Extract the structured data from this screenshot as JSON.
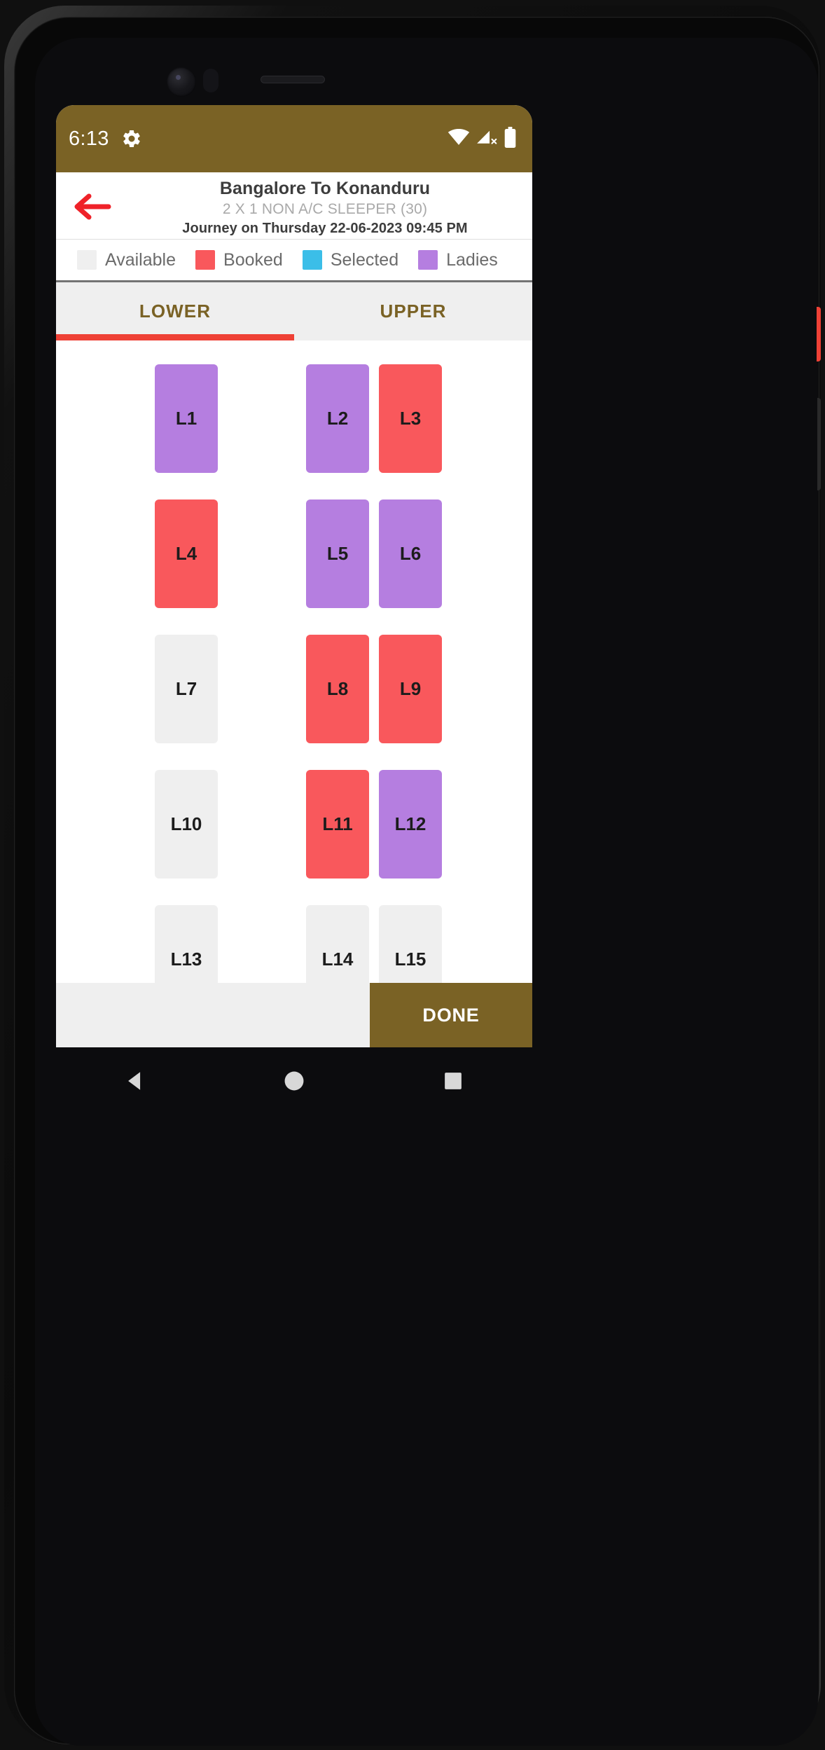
{
  "status_bar": {
    "time": "6:13",
    "gear_icon": "gear-icon",
    "wifi_icon": "wifi-icon",
    "signal_icon": "cellular-signal-off-icon",
    "battery_icon": "battery-icon",
    "background_color": "#7a6225"
  },
  "header": {
    "back_icon": "back-arrow-icon",
    "back_icon_color": "#ef2229",
    "route_title": "Bangalore To Konanduru",
    "bus_type": "2 X 1 NON A/C SLEEPER (30)",
    "journey_info": "Journey on Thursday 22-06-2023  09:45 PM"
  },
  "legend": {
    "items": [
      {
        "label": "Available",
        "color": "#efefef"
      },
      {
        "label": "Booked",
        "color": "#f9585c"
      },
      {
        "label": "Selected",
        "color": "#3bbee8"
      },
      {
        "label": "Ladies",
        "color": "#b57ee0"
      }
    ]
  },
  "tabs": {
    "items": [
      {
        "label": "LOWER",
        "active": true
      },
      {
        "label": "UPPER",
        "active": false
      }
    ],
    "active_color": "#7a6225",
    "underline_color": "#ef4136"
  },
  "seat_map": {
    "rows": [
      [
        {
          "label": "",
          "state": "empty"
        },
        {
          "label": "L1",
          "state": "ladies"
        },
        {
          "gap": true
        },
        {
          "label": "L2",
          "state": "ladies"
        },
        {
          "label": "L3",
          "state": "booked"
        }
      ],
      [
        {
          "label": "",
          "state": "empty"
        },
        {
          "label": "L4",
          "state": "booked"
        },
        {
          "gap": true
        },
        {
          "label": "L5",
          "state": "ladies"
        },
        {
          "label": "L6",
          "state": "ladies"
        }
      ],
      [
        {
          "label": "",
          "state": "empty"
        },
        {
          "label": "L7",
          "state": "available"
        },
        {
          "gap": true
        },
        {
          "label": "L8",
          "state": "booked"
        },
        {
          "label": "L9",
          "state": "booked"
        }
      ],
      [
        {
          "label": "",
          "state": "empty"
        },
        {
          "label": "L10",
          "state": "available"
        },
        {
          "gap": true
        },
        {
          "label": "L11",
          "state": "booked"
        },
        {
          "label": "L12",
          "state": "ladies"
        }
      ],
      [
        {
          "label": "",
          "state": "empty"
        },
        {
          "label": "L13",
          "state": "available"
        },
        {
          "gap": true
        },
        {
          "label": "L14",
          "state": "available"
        },
        {
          "label": "L15",
          "state": "available"
        }
      ]
    ],
    "state_colors": {
      "available": "#efefef",
      "booked": "#f9585c",
      "selected": "#3bbee8",
      "ladies": "#b57ee0",
      "empty": "transparent"
    }
  },
  "bottom_bar": {
    "done_label": "DONE",
    "done_color": "#7a6225",
    "background_color": "#efefef"
  },
  "nav_bar": {
    "back_icon": "android-back-triangle-icon",
    "home_icon": "android-home-circle-icon",
    "recents_icon": "android-recents-square-icon"
  }
}
